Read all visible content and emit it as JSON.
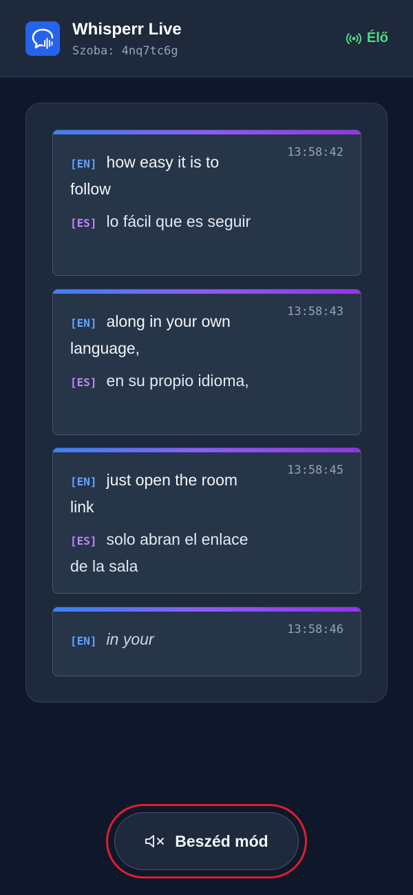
{
  "header": {
    "title": "Whisperr Live",
    "room_label": "Szoba:",
    "room_code": "4nq7tc6g",
    "status": "Élő",
    "status_color": "#4ade80"
  },
  "transcripts": [
    {
      "time": "13:58:42",
      "en_tag": "[EN]",
      "en_text": "how easy it is to follow",
      "es_tag": "[ES]",
      "es_text": "lo fácil que es seguir"
    },
    {
      "time": "13:58:43",
      "en_tag": "[EN]",
      "en_text": "along in your own language,",
      "es_tag": "[ES]",
      "es_text": "en su propio idioma,"
    },
    {
      "time": "13:58:45",
      "en_tag": "[EN]",
      "en_text": "just open the room link",
      "es_tag": "[ES]",
      "es_text": "solo abran el enlace de la sala"
    },
    {
      "time": "13:58:46",
      "en_tag": "[EN]",
      "en_text": "in your"
    }
  ],
  "speech_button": {
    "label": "Beszéd mód",
    "icon": "speaker-muted-icon"
  },
  "colors": {
    "accent_blue": "#3b82f6",
    "accent_purple": "#9333ea",
    "highlight_ring": "#e11d2e"
  }
}
